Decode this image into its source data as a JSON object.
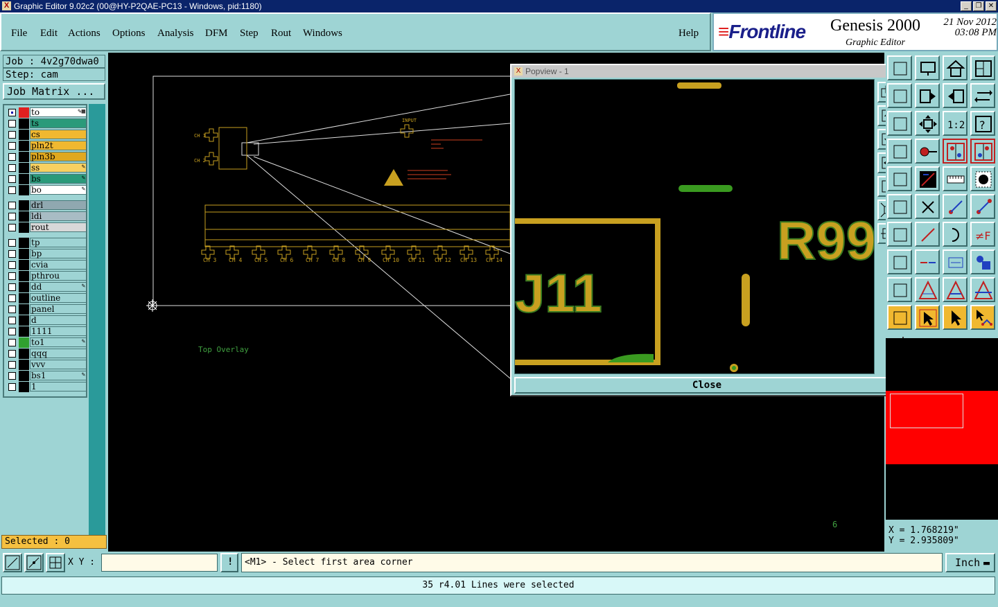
{
  "window": {
    "title": "Graphic Editor 9.02c2 (00@HY-P2QAE-PC13 - Windows, pid:1180)",
    "app_icon": "x-window-icon"
  },
  "menu": {
    "items": [
      "File",
      "Edit",
      "Actions",
      "Options",
      "Analysis",
      "DFM",
      "Step",
      "Rout",
      "Windows"
    ],
    "help": "Help"
  },
  "brand": {
    "logo": "Frontline",
    "product": "Genesis 2000",
    "subtitle": "Graphic Editor",
    "date": "21 Nov 2012",
    "time": "03:08 PM"
  },
  "job": {
    "job_label": "Job : 4v2g70dwa0",
    "step_label": "Step: cam",
    "matrix_button": "Job Matrix ..."
  },
  "layers": [
    {
      "name": "to",
      "color": "#e02020",
      "bg": "#ffffff",
      "active": true,
      "mark": "✎▦"
    },
    {
      "name": "ts",
      "color": "#000000",
      "bg": "#2a9a7a",
      "active": false,
      "mark": ""
    },
    {
      "name": "cs",
      "color": "#000000",
      "bg": "#f0b830",
      "active": false,
      "mark": ""
    },
    {
      "name": "pln2t",
      "color": "#000000",
      "bg": "#f0b830",
      "active": false,
      "mark": ""
    },
    {
      "name": "pln3b",
      "color": "#000000",
      "bg": "#e0a820",
      "active": false,
      "mark": ""
    },
    {
      "name": "ss",
      "color": "#000000",
      "bg": "#f8d060",
      "active": false,
      "mark": "✎"
    },
    {
      "name": "bs",
      "color": "#000000",
      "bg": "#2a9a7a",
      "active": false,
      "mark": "✎"
    },
    {
      "name": "bo",
      "color": "#000000",
      "bg": "#ffffff",
      "active": false,
      "mark": "✎"
    },
    {
      "name": "drl",
      "color": "#000000",
      "bg": "#90a8b0",
      "active": false,
      "mark": ""
    },
    {
      "name": "ldi",
      "color": "#000000",
      "bg": "#a8bcc4",
      "active": false,
      "mark": ""
    },
    {
      "name": "rout",
      "color": "#000000",
      "bg": "#d8d8d8",
      "active": false,
      "mark": ""
    },
    {
      "name": "tp",
      "color": "#000000",
      "bg": "#9ed4d4",
      "active": false,
      "mark": ""
    },
    {
      "name": "bp",
      "color": "#000000",
      "bg": "#9ed4d4",
      "active": false,
      "mark": ""
    },
    {
      "name": "cvia",
      "color": "#000000",
      "bg": "#9ed4d4",
      "active": false,
      "mark": ""
    },
    {
      "name": "pthrou",
      "color": "#000000",
      "bg": "#9ed4d4",
      "active": false,
      "mark": ""
    },
    {
      "name": "dd",
      "color": "#000000",
      "bg": "#9ed4d4",
      "active": false,
      "mark": "✎"
    },
    {
      "name": "outline",
      "color": "#000000",
      "bg": "#9ed4d4",
      "active": false,
      "mark": ""
    },
    {
      "name": "panel",
      "color": "#000000",
      "bg": "#9ed4d4",
      "active": false,
      "mark": ""
    },
    {
      "name": "d",
      "color": "#000000",
      "bg": "#9ed4d4",
      "active": false,
      "mark": ""
    },
    {
      "name": "1111",
      "color": "#000000",
      "bg": "#9ed4d4",
      "active": false,
      "mark": ""
    },
    {
      "name": "to1",
      "color": "#30a030",
      "bg": "#9ed4d4",
      "active": false,
      "mark": "✎"
    },
    {
      "name": "qqq",
      "color": "#000000",
      "bg": "#9ed4d4",
      "active": false,
      "mark": ""
    },
    {
      "name": "vvv",
      "color": "#000000",
      "bg": "#9ed4d4",
      "active": false,
      "mark": ""
    },
    {
      "name": "bs1",
      "color": "#000000",
      "bg": "#9ed4d4",
      "active": false,
      "mark": "✎"
    },
    {
      "name": "1",
      "color": "#000000",
      "bg": "#9ed4d4",
      "active": false,
      "mark": ""
    }
  ],
  "selected_label": "Selected : 0",
  "canvas": {
    "overlay_label": "Top Overlay",
    "corner_label": "6",
    "input_label": "INPUT",
    "channel_labels_top": [
      "CH 1",
      "CH 2"
    ],
    "channel_labels": [
      "CH 3",
      "CH 4",
      "CH 5",
      "CH 6",
      "CH 7",
      "CH 8",
      "CH 9",
      "CH 10",
      "CH 11",
      "CH 12",
      "CH 13",
      "CH 14"
    ]
  },
  "popview": {
    "title": "Popview - 1",
    "text_left": "J11",
    "text_right": "R99",
    "close_label": "Close"
  },
  "coords": {
    "x": "X = 1.768219\"",
    "y": "Y = 2.935809\""
  },
  "bottom": {
    "xy_label": "X Y :",
    "xy_value": "",
    "info_button": "!",
    "prompt": "<M1> - Select first area corner",
    "unit": "Inch"
  },
  "status": "35 r4.01 Lines were selected",
  "colors": {
    "panel": "#9ed4d4",
    "gold": "#c8a020",
    "green": "#3a9a20",
    "canvas": "#000000"
  }
}
